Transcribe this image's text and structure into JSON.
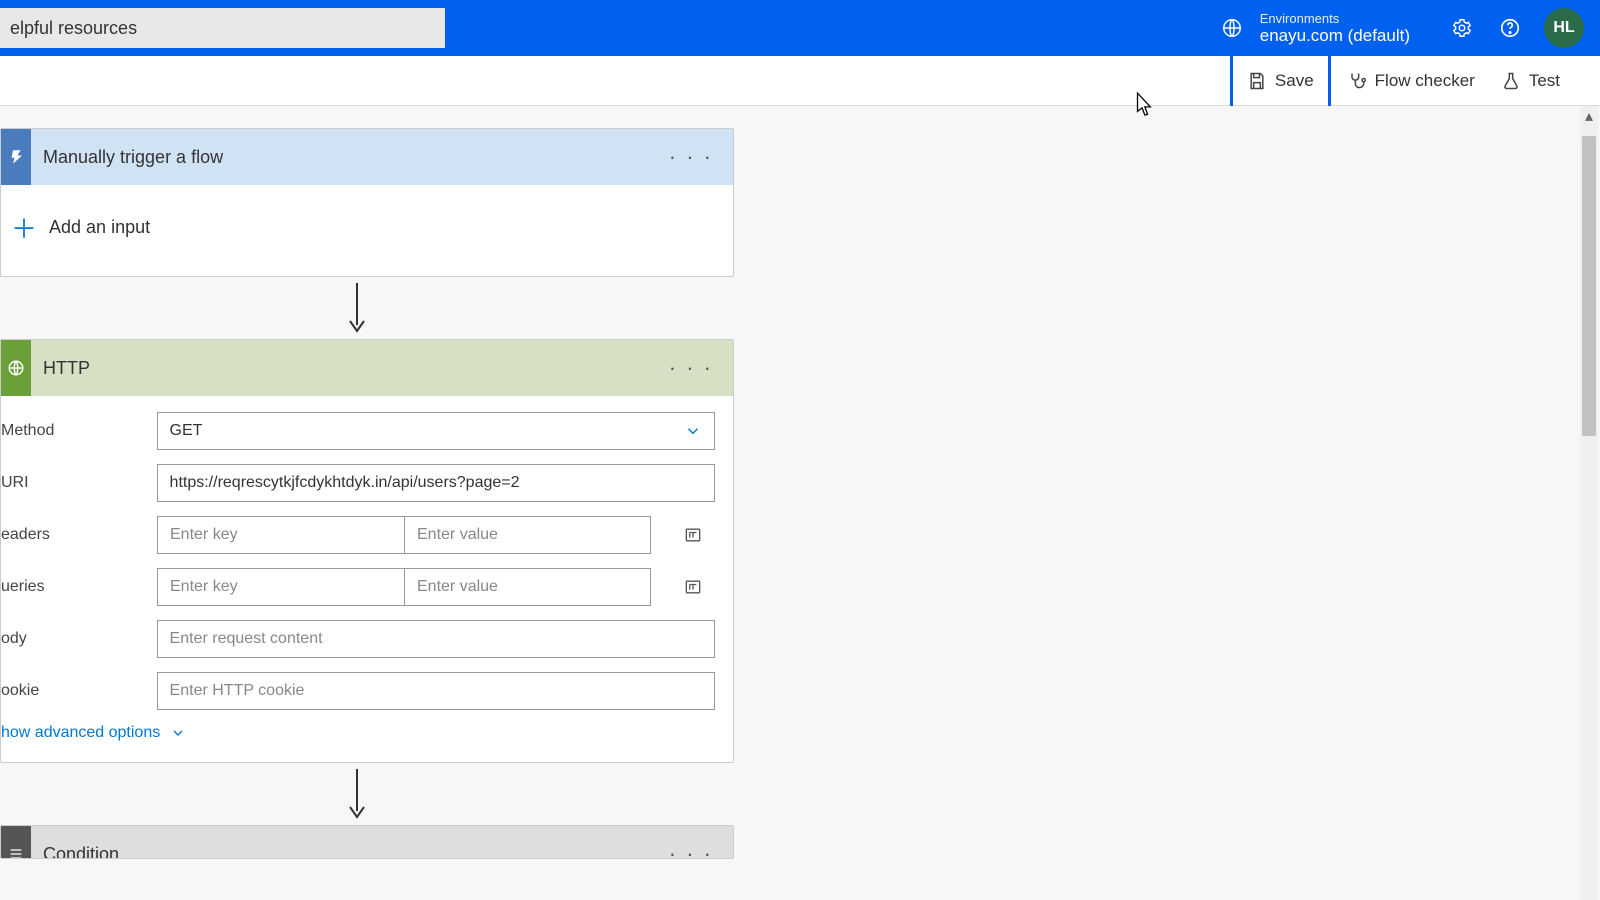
{
  "topbar": {
    "search_value": "elpful resources",
    "env_label": "Environments",
    "env_value": "enayu.com (default)",
    "avatar_initials": "HL"
  },
  "toolbar": {
    "save_label": "Save",
    "flow_checker_label": "Flow checker",
    "test_label": "Test"
  },
  "trigger_card": {
    "title": "Manually trigger a flow",
    "add_input_label": "Add an input"
  },
  "http_card": {
    "title": "HTTP",
    "labels": {
      "method": "Method",
      "uri": "URI",
      "headers": "eaders",
      "queries": "ueries",
      "body": "ody",
      "cookie": "ookie"
    },
    "method_value": "GET",
    "uri_value": "https://reqrescytkjfcdykhtdyk.in/api/users?page=2",
    "placeholders": {
      "key": "Enter key",
      "value": "Enter value",
      "body": "Enter request content",
      "cookie": "Enter HTTP cookie"
    },
    "advanced_label": "how advanced options"
  },
  "condition_card": {
    "title": "Condition"
  }
}
